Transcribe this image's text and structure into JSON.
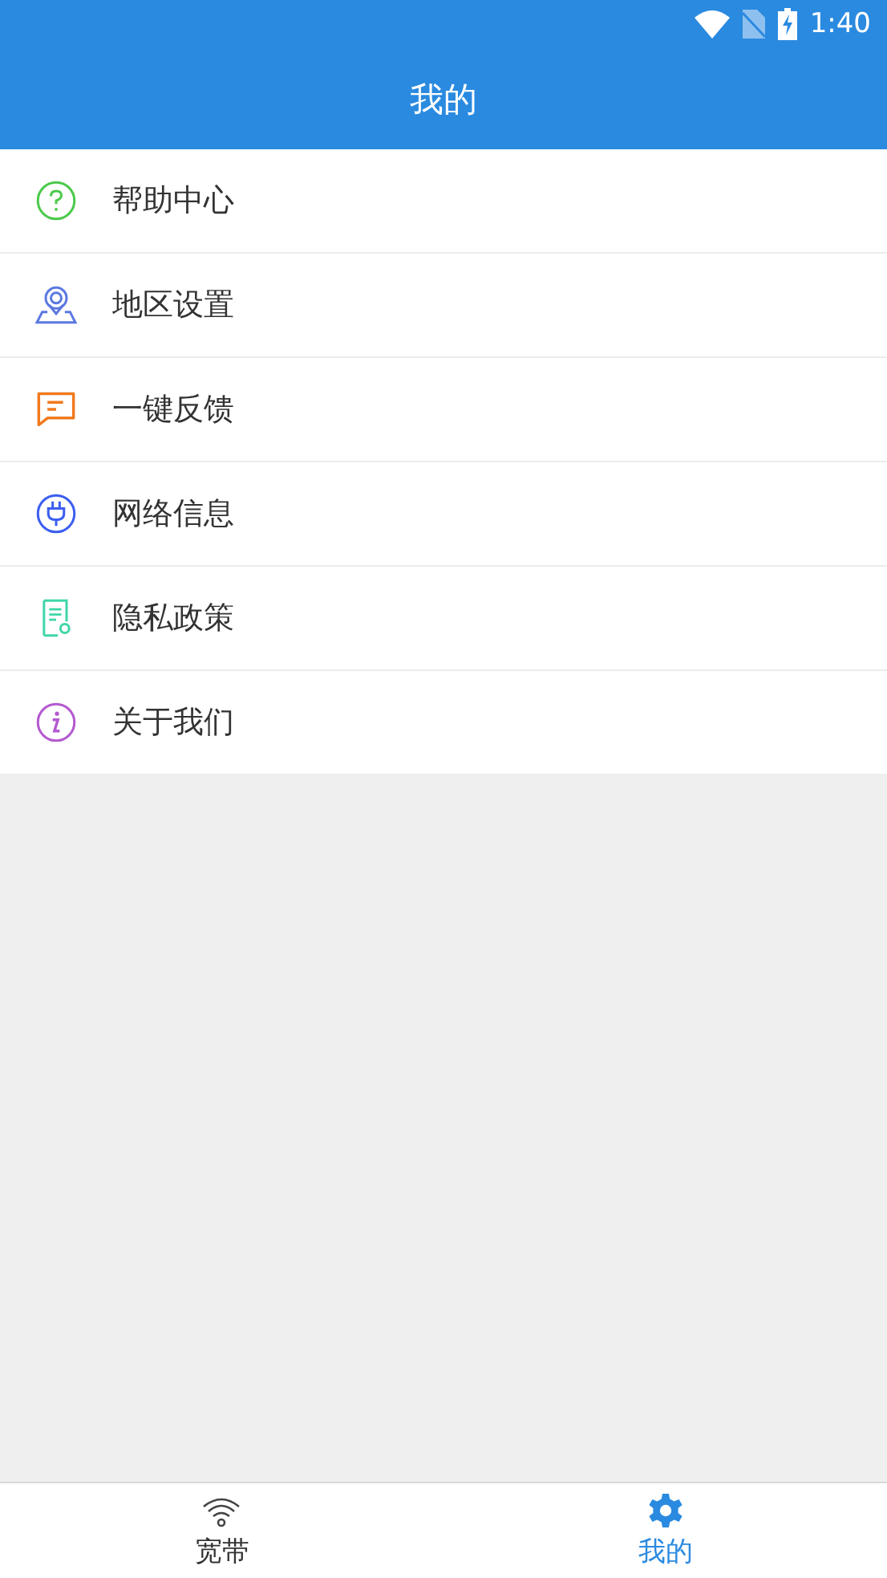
{
  "status_bar": {
    "time": "1:40"
  },
  "header": {
    "title": "我的"
  },
  "menu": [
    {
      "label": "帮助中心",
      "color": "#4cc94c"
    },
    {
      "label": "地区设置",
      "color": "#5b78e0"
    },
    {
      "label": "一键反馈",
      "color": "#f07a1e"
    },
    {
      "label": "网络信息",
      "color": "#3c5ef0"
    },
    {
      "label": "隐私政策",
      "color": "#3fd6a8"
    },
    {
      "label": "关于我们",
      "color": "#b45ad0"
    }
  ],
  "bottom_nav": [
    {
      "label": "宽带",
      "selected": false
    },
    {
      "label": "我的",
      "selected": true
    }
  ]
}
